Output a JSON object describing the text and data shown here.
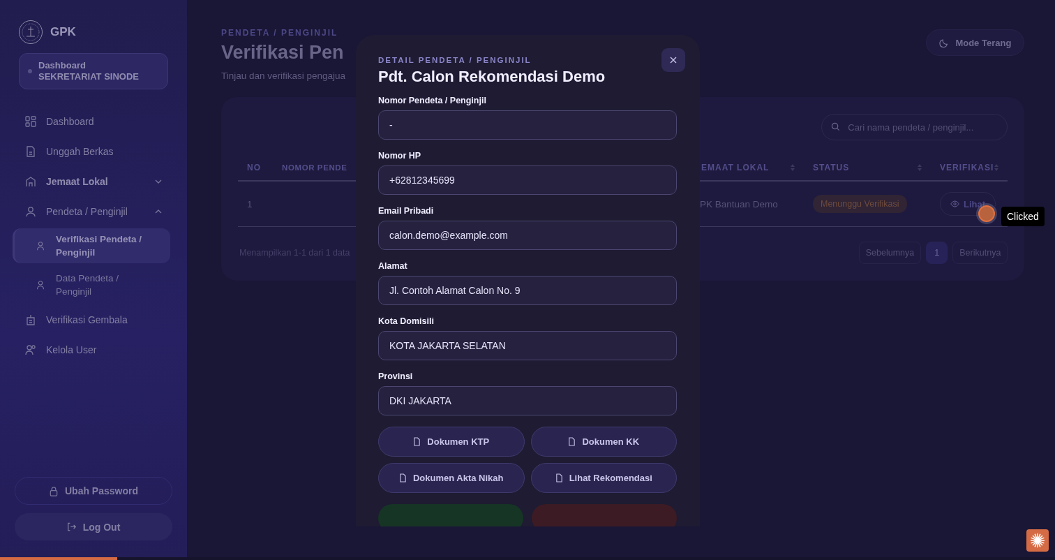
{
  "sidebar": {
    "brand": "GPK",
    "role": {
      "line1": "Dashboard",
      "line2": "SEKRETARIAT SINODE"
    },
    "items": [
      {
        "label": "Dashboard",
        "kind": "link",
        "selected": false
      },
      {
        "label": "Unggah Berkas",
        "kind": "link",
        "selected": false
      },
      {
        "label": "Jemaat Lokal",
        "kind": "group",
        "expanded": false,
        "selected": false
      },
      {
        "label": "Pendeta / Penginjil",
        "kind": "group",
        "expanded": true,
        "selected": false,
        "children": [
          {
            "label": "Verifikasi Pendeta / Penginjil",
            "selected": true
          },
          {
            "label": "Data Pendeta / Penginjil",
            "selected": false
          }
        ]
      },
      {
        "label": "Verifikasi Gembala",
        "kind": "link",
        "selected": false
      },
      {
        "label": "Kelola User",
        "kind": "link",
        "selected": false
      }
    ],
    "buttons": [
      "Ubah Password",
      "Log Out"
    ]
  },
  "header": {
    "breadcrumb": "PENDETA / PENGINJIL",
    "title": "Verifikasi Pen",
    "subtitle": "Tinjau dan verifikasi pengajua",
    "theme_button": "Mode Terang"
  },
  "table": {
    "search": {
      "placeholder": "Cari nama pendeta / penginjil..."
    },
    "columns": [
      "NO",
      "NOMOR PENDE",
      "EMAAT LOKAL",
      "STATUS",
      "VERIFIKASI"
    ],
    "rows": [
      {
        "no": "1",
        "church": "PK Bantuan Demo",
        "status": "Menunggu Verifikasi",
        "action": "Lihat"
      }
    ],
    "footer": "Menampilkan 1-1 dari 1 data",
    "pagination": {
      "prev": "Sebelumnya",
      "pages": [
        {
          "label": "1",
          "selected": true
        }
      ],
      "next": "Berikutnya"
    }
  },
  "modal": {
    "eyebrow": "DETAIL PENDETA / PENGINJIL",
    "title": "Pdt. Calon Rekomendasi Demo",
    "fields": [
      {
        "label": "Nomor Pendeta / Penginjil",
        "value": "-"
      },
      {
        "label": "Nomor HP",
        "value": "+62812345699"
      },
      {
        "label": "Email Pribadi",
        "value": "calon.demo@example.com"
      },
      {
        "label": "Alamat",
        "value": "Jl. Contoh Alamat Calon No. 9"
      },
      {
        "label": "Kota Domisili",
        "value": "KOTA JAKARTA SELATAN"
      },
      {
        "label": "Provinsi",
        "value": "DKI JAKARTA"
      }
    ],
    "documents": [
      "Dokumen KTP",
      "Dokumen KK",
      "Dokumen Akta Nikah",
      "Lihat Rekomendasi"
    ],
    "actions": [
      {
        "kind": "approve"
      },
      {
        "kind": "reject"
      }
    ]
  },
  "click_marker": {
    "label": "Clicked"
  },
  "loading_bar": {
    "level": 0.111
  }
}
